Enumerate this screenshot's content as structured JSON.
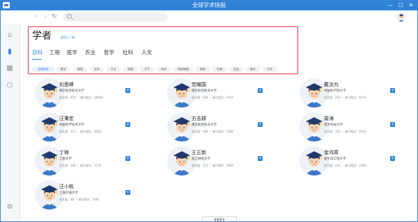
{
  "window": {
    "title": "全球学术快报"
  },
  "toolbar": {
    "back": "‹",
    "forward": "›",
    "refresh": "↻",
    "search_placeholder": ""
  },
  "page": {
    "title": "学者",
    "back_link": "返回上一级"
  },
  "tabs": [
    {
      "label": "自科",
      "active": true
    },
    {
      "label": "工程",
      "active": false
    },
    {
      "label": "医学",
      "active": false
    },
    {
      "label": "农业",
      "active": false
    },
    {
      "label": "哲学",
      "active": false
    },
    {
      "label": "社科",
      "active": false
    },
    {
      "label": "人文",
      "active": false
    }
  ],
  "chips": [
    {
      "label": "系统科学",
      "active": true
    },
    {
      "label": "数学"
    },
    {
      "label": "物理"
    },
    {
      "label": "化学"
    },
    {
      "label": "天文"
    },
    {
      "label": "地理"
    },
    {
      "label": "大气"
    },
    {
      "label": "海洋"
    },
    {
      "label": "地球物理"
    },
    {
      "label": "地质"
    },
    {
      "label": "生物"
    },
    {
      "label": "生态"
    },
    {
      "label": "统计"
    },
    {
      "label": "力学"
    }
  ],
  "scholars": [
    {
      "name": "刘思峰",
      "inst": "南京航空航天大学",
      "stats": "发文量：879 ｜ 被引频次：26684"
    },
    {
      "name": "党耀国",
      "inst": "南京航空航天大学",
      "stats": "发文量：268 ｜ 被引频次：9233"
    },
    {
      "name": "戴汝为",
      "inst": "中国科学院大学",
      "stats": "发文量：243 ｜ 被引频次：9174"
    },
    {
      "name": "汪秉宏",
      "inst": "中国科学技术大学",
      "stats": "发文量：212 ｜ 被引频次：8264"
    },
    {
      "name": "方志耕",
      "inst": "南京航空航天大学",
      "stats": "发文量：368 ｜ 被引频次：5282"
    },
    {
      "name": "周涛",
      "inst": "电子科技大学",
      "stats": "发文量：161 ｜ 被引频次：7624"
    },
    {
      "name": "丁锋",
      "inst": "江南大学",
      "stats": "发文量：184 ｜ 被引频次：3720"
    },
    {
      "name": "王正新",
      "inst": "浙江财经大学",
      "stats": "发文量：110 ｜ 被引频次：3982"
    },
    {
      "name": "金鸿章",
      "inst": "哈尔滨工程大学",
      "stats": "发文量：244 ｜ 被引频次：3494"
    },
    {
      "name": "汪小帆",
      "inst": "上海交通大学",
      "stats": "发文量：86 ｜ 被引频次：3961"
    }
  ],
  "more_button": "查看更多",
  "colors": {
    "accent": "#2f82d8",
    "highlight_border": "#e3343a"
  }
}
